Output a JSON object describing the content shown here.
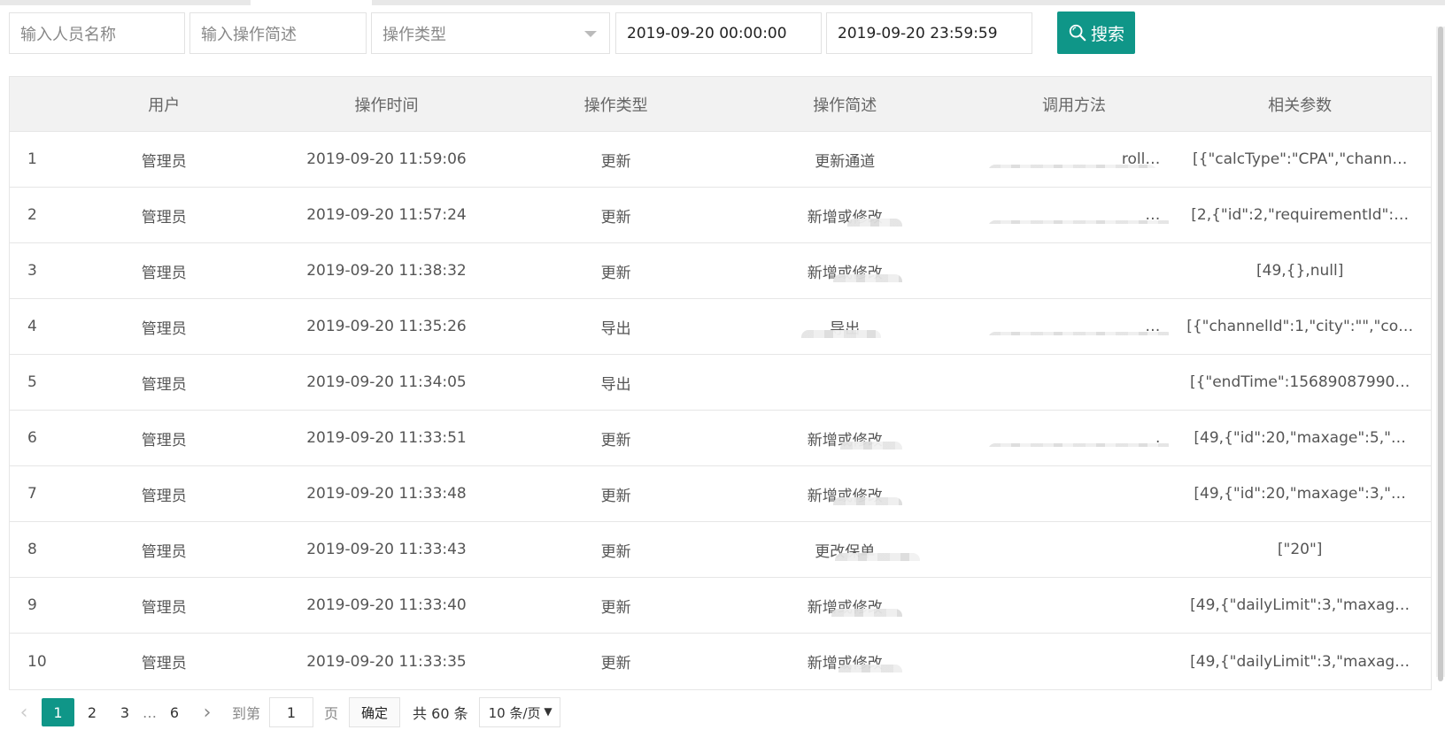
{
  "filters": {
    "name_placeholder": "输入人员名称",
    "desc_placeholder": "输入操作简述",
    "type_placeholder": "操作类型",
    "start_time": "2019-09-20 00:00:00",
    "end_time": "2019-09-20 23:59:59",
    "search_label": "搜索"
  },
  "table": {
    "headers": [
      "",
      "用户",
      "操作时间",
      "操作类型",
      "操作简述",
      "调用方法",
      "相关参数"
    ],
    "rows": [
      {
        "idx": "1",
        "user": "管理员",
        "time": "2019-09-20 11:59:06",
        "type": "更新",
        "desc": "更新通道",
        "method": "roll…",
        "params": "[{\"calcType\":\"CPA\",\"chann…"
      },
      {
        "idx": "2",
        "user": "管理员",
        "time": "2019-09-20 11:57:24",
        "type": "更新",
        "desc": "新增或修改",
        "method": "…",
        "params": "[2,{\"id\":2,\"requirementId\":…"
      },
      {
        "idx": "3",
        "user": "管理员",
        "time": "2019-09-20 11:38:32",
        "type": "更新",
        "desc": "新增或修改",
        "method": "",
        "params": "[49,{},null]"
      },
      {
        "idx": "4",
        "user": "管理员",
        "time": "2019-09-20 11:35:26",
        "type": "导出",
        "desc": "导出",
        "method": "…",
        "params": "[{\"channelId\":1,\"city\":\"\",\"co…"
      },
      {
        "idx": "5",
        "user": "管理员",
        "time": "2019-09-20 11:34:05",
        "type": "导出",
        "desc": "",
        "method": "",
        "params": "[{\"endTime\":15689087990…"
      },
      {
        "idx": "6",
        "user": "管理员",
        "time": "2019-09-20 11:33:51",
        "type": "更新",
        "desc": "新增或修改",
        "method": ".",
        "params": "[49,{\"id\":20,\"maxage\":5,\"…"
      },
      {
        "idx": "7",
        "user": "管理员",
        "time": "2019-09-20 11:33:48",
        "type": "更新",
        "desc": "新增或修改",
        "method": "",
        "params": "[49,{\"id\":20,\"maxage\":3,\"…"
      },
      {
        "idx": "8",
        "user": "管理员",
        "time": "2019-09-20 11:33:43",
        "type": "更新",
        "desc": "更改保单",
        "method": "",
        "params": "[\"20\"]"
      },
      {
        "idx": "9",
        "user": "管理员",
        "time": "2019-09-20 11:33:40",
        "type": "更新",
        "desc": "新增或修改",
        "method": "",
        "params": "[49,{\"dailyLimit\":3,\"maxag…"
      },
      {
        "idx": "10",
        "user": "管理员",
        "time": "2019-09-20 11:33:35",
        "type": "更新",
        "desc": "新增或修改",
        "method": "",
        "params": "[49,{\"dailyLimit\":3,\"maxag…"
      }
    ]
  },
  "pager": {
    "prev_icon": "‹",
    "pages": [
      "1",
      "2",
      "3"
    ],
    "ellipsis": "…",
    "last_page": "6",
    "next_icon": "›",
    "goto_label": "到第",
    "goto_value": "1",
    "page_unit": "页",
    "confirm_label": "确定",
    "total_label": "共 60 条",
    "size_label": "10 条/页",
    "size_arrow": "▼"
  },
  "colors": {
    "accent": "#0f9688"
  }
}
